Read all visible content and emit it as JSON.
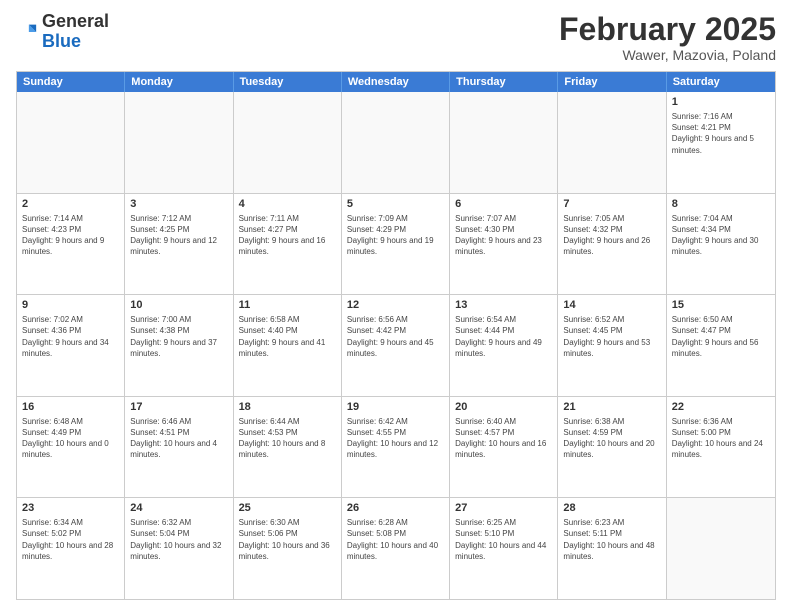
{
  "logo": {
    "general": "General",
    "blue": "Blue"
  },
  "header": {
    "month": "February 2025",
    "location": "Wawer, Mazovia, Poland"
  },
  "weekdays": [
    "Sunday",
    "Monday",
    "Tuesday",
    "Wednesday",
    "Thursday",
    "Friday",
    "Saturday"
  ],
  "weeks": [
    [
      {
        "day": "",
        "info": ""
      },
      {
        "day": "",
        "info": ""
      },
      {
        "day": "",
        "info": ""
      },
      {
        "day": "",
        "info": ""
      },
      {
        "day": "",
        "info": ""
      },
      {
        "day": "",
        "info": ""
      },
      {
        "day": "1",
        "info": "Sunrise: 7:16 AM\nSunset: 4:21 PM\nDaylight: 9 hours and 5 minutes."
      }
    ],
    [
      {
        "day": "2",
        "info": "Sunrise: 7:14 AM\nSunset: 4:23 PM\nDaylight: 9 hours and 9 minutes."
      },
      {
        "day": "3",
        "info": "Sunrise: 7:12 AM\nSunset: 4:25 PM\nDaylight: 9 hours and 12 minutes."
      },
      {
        "day": "4",
        "info": "Sunrise: 7:11 AM\nSunset: 4:27 PM\nDaylight: 9 hours and 16 minutes."
      },
      {
        "day": "5",
        "info": "Sunrise: 7:09 AM\nSunset: 4:29 PM\nDaylight: 9 hours and 19 minutes."
      },
      {
        "day": "6",
        "info": "Sunrise: 7:07 AM\nSunset: 4:30 PM\nDaylight: 9 hours and 23 minutes."
      },
      {
        "day": "7",
        "info": "Sunrise: 7:05 AM\nSunset: 4:32 PM\nDaylight: 9 hours and 26 minutes."
      },
      {
        "day": "8",
        "info": "Sunrise: 7:04 AM\nSunset: 4:34 PM\nDaylight: 9 hours and 30 minutes."
      }
    ],
    [
      {
        "day": "9",
        "info": "Sunrise: 7:02 AM\nSunset: 4:36 PM\nDaylight: 9 hours and 34 minutes."
      },
      {
        "day": "10",
        "info": "Sunrise: 7:00 AM\nSunset: 4:38 PM\nDaylight: 9 hours and 37 minutes."
      },
      {
        "day": "11",
        "info": "Sunrise: 6:58 AM\nSunset: 4:40 PM\nDaylight: 9 hours and 41 minutes."
      },
      {
        "day": "12",
        "info": "Sunrise: 6:56 AM\nSunset: 4:42 PM\nDaylight: 9 hours and 45 minutes."
      },
      {
        "day": "13",
        "info": "Sunrise: 6:54 AM\nSunset: 4:44 PM\nDaylight: 9 hours and 49 minutes."
      },
      {
        "day": "14",
        "info": "Sunrise: 6:52 AM\nSunset: 4:45 PM\nDaylight: 9 hours and 53 minutes."
      },
      {
        "day": "15",
        "info": "Sunrise: 6:50 AM\nSunset: 4:47 PM\nDaylight: 9 hours and 56 minutes."
      }
    ],
    [
      {
        "day": "16",
        "info": "Sunrise: 6:48 AM\nSunset: 4:49 PM\nDaylight: 10 hours and 0 minutes."
      },
      {
        "day": "17",
        "info": "Sunrise: 6:46 AM\nSunset: 4:51 PM\nDaylight: 10 hours and 4 minutes."
      },
      {
        "day": "18",
        "info": "Sunrise: 6:44 AM\nSunset: 4:53 PM\nDaylight: 10 hours and 8 minutes."
      },
      {
        "day": "19",
        "info": "Sunrise: 6:42 AM\nSunset: 4:55 PM\nDaylight: 10 hours and 12 minutes."
      },
      {
        "day": "20",
        "info": "Sunrise: 6:40 AM\nSunset: 4:57 PM\nDaylight: 10 hours and 16 minutes."
      },
      {
        "day": "21",
        "info": "Sunrise: 6:38 AM\nSunset: 4:59 PM\nDaylight: 10 hours and 20 minutes."
      },
      {
        "day": "22",
        "info": "Sunrise: 6:36 AM\nSunset: 5:00 PM\nDaylight: 10 hours and 24 minutes."
      }
    ],
    [
      {
        "day": "23",
        "info": "Sunrise: 6:34 AM\nSunset: 5:02 PM\nDaylight: 10 hours and 28 minutes."
      },
      {
        "day": "24",
        "info": "Sunrise: 6:32 AM\nSunset: 5:04 PM\nDaylight: 10 hours and 32 minutes."
      },
      {
        "day": "25",
        "info": "Sunrise: 6:30 AM\nSunset: 5:06 PM\nDaylight: 10 hours and 36 minutes."
      },
      {
        "day": "26",
        "info": "Sunrise: 6:28 AM\nSunset: 5:08 PM\nDaylight: 10 hours and 40 minutes."
      },
      {
        "day": "27",
        "info": "Sunrise: 6:25 AM\nSunset: 5:10 PM\nDaylight: 10 hours and 44 minutes."
      },
      {
        "day": "28",
        "info": "Sunrise: 6:23 AM\nSunset: 5:11 PM\nDaylight: 10 hours and 48 minutes."
      },
      {
        "day": "",
        "info": ""
      }
    ]
  ]
}
